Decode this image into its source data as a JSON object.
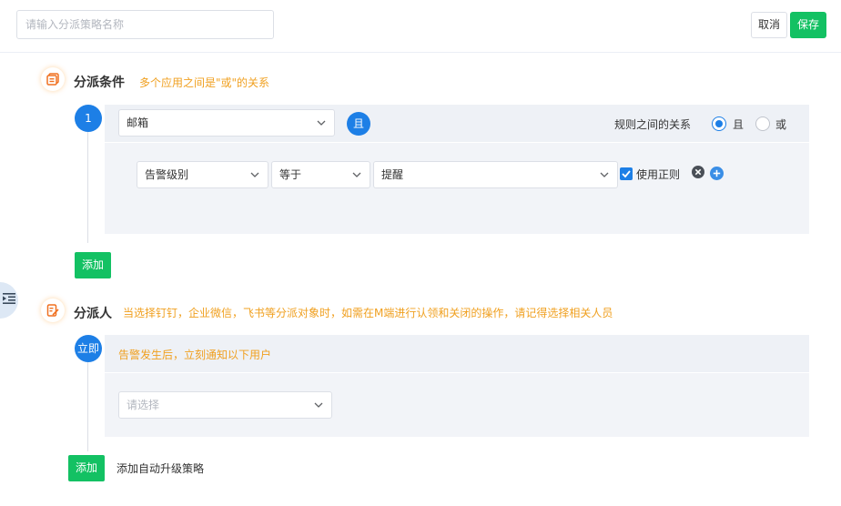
{
  "header": {
    "name_placeholder": "请输入分派策略名称",
    "cancel_label": "取消",
    "save_label": "保存"
  },
  "conditions": {
    "title": "分派条件",
    "hint": "多个应用之间是\"或\"的关系",
    "step_label": "1",
    "channel_value": "邮箱",
    "and_badge": "且",
    "relation_label": "规则之间的关系",
    "relation_options": [
      "且",
      "或"
    ],
    "relation_selected": "且",
    "rule": {
      "field": "告警级别",
      "operator": "等于",
      "value": "提醒",
      "regex_label": "使用正则",
      "regex_checked": true
    },
    "add_label": "添加"
  },
  "assignees": {
    "title": "分派人",
    "hint": "当选择钉钉，企业微信，飞书等分派对象时，如需在M端进行认领和关闭的操作，请记得选择相关人员",
    "step_label": "立即",
    "notify_text": "告警发生后，立刻通知以下用户",
    "user_placeholder": "请选择",
    "add_label": "添加",
    "escalation_label": "添加自动升级策略"
  },
  "colors": {
    "primary": "#1d7fe6",
    "success": "#13c163",
    "warning": "#f0a020"
  }
}
